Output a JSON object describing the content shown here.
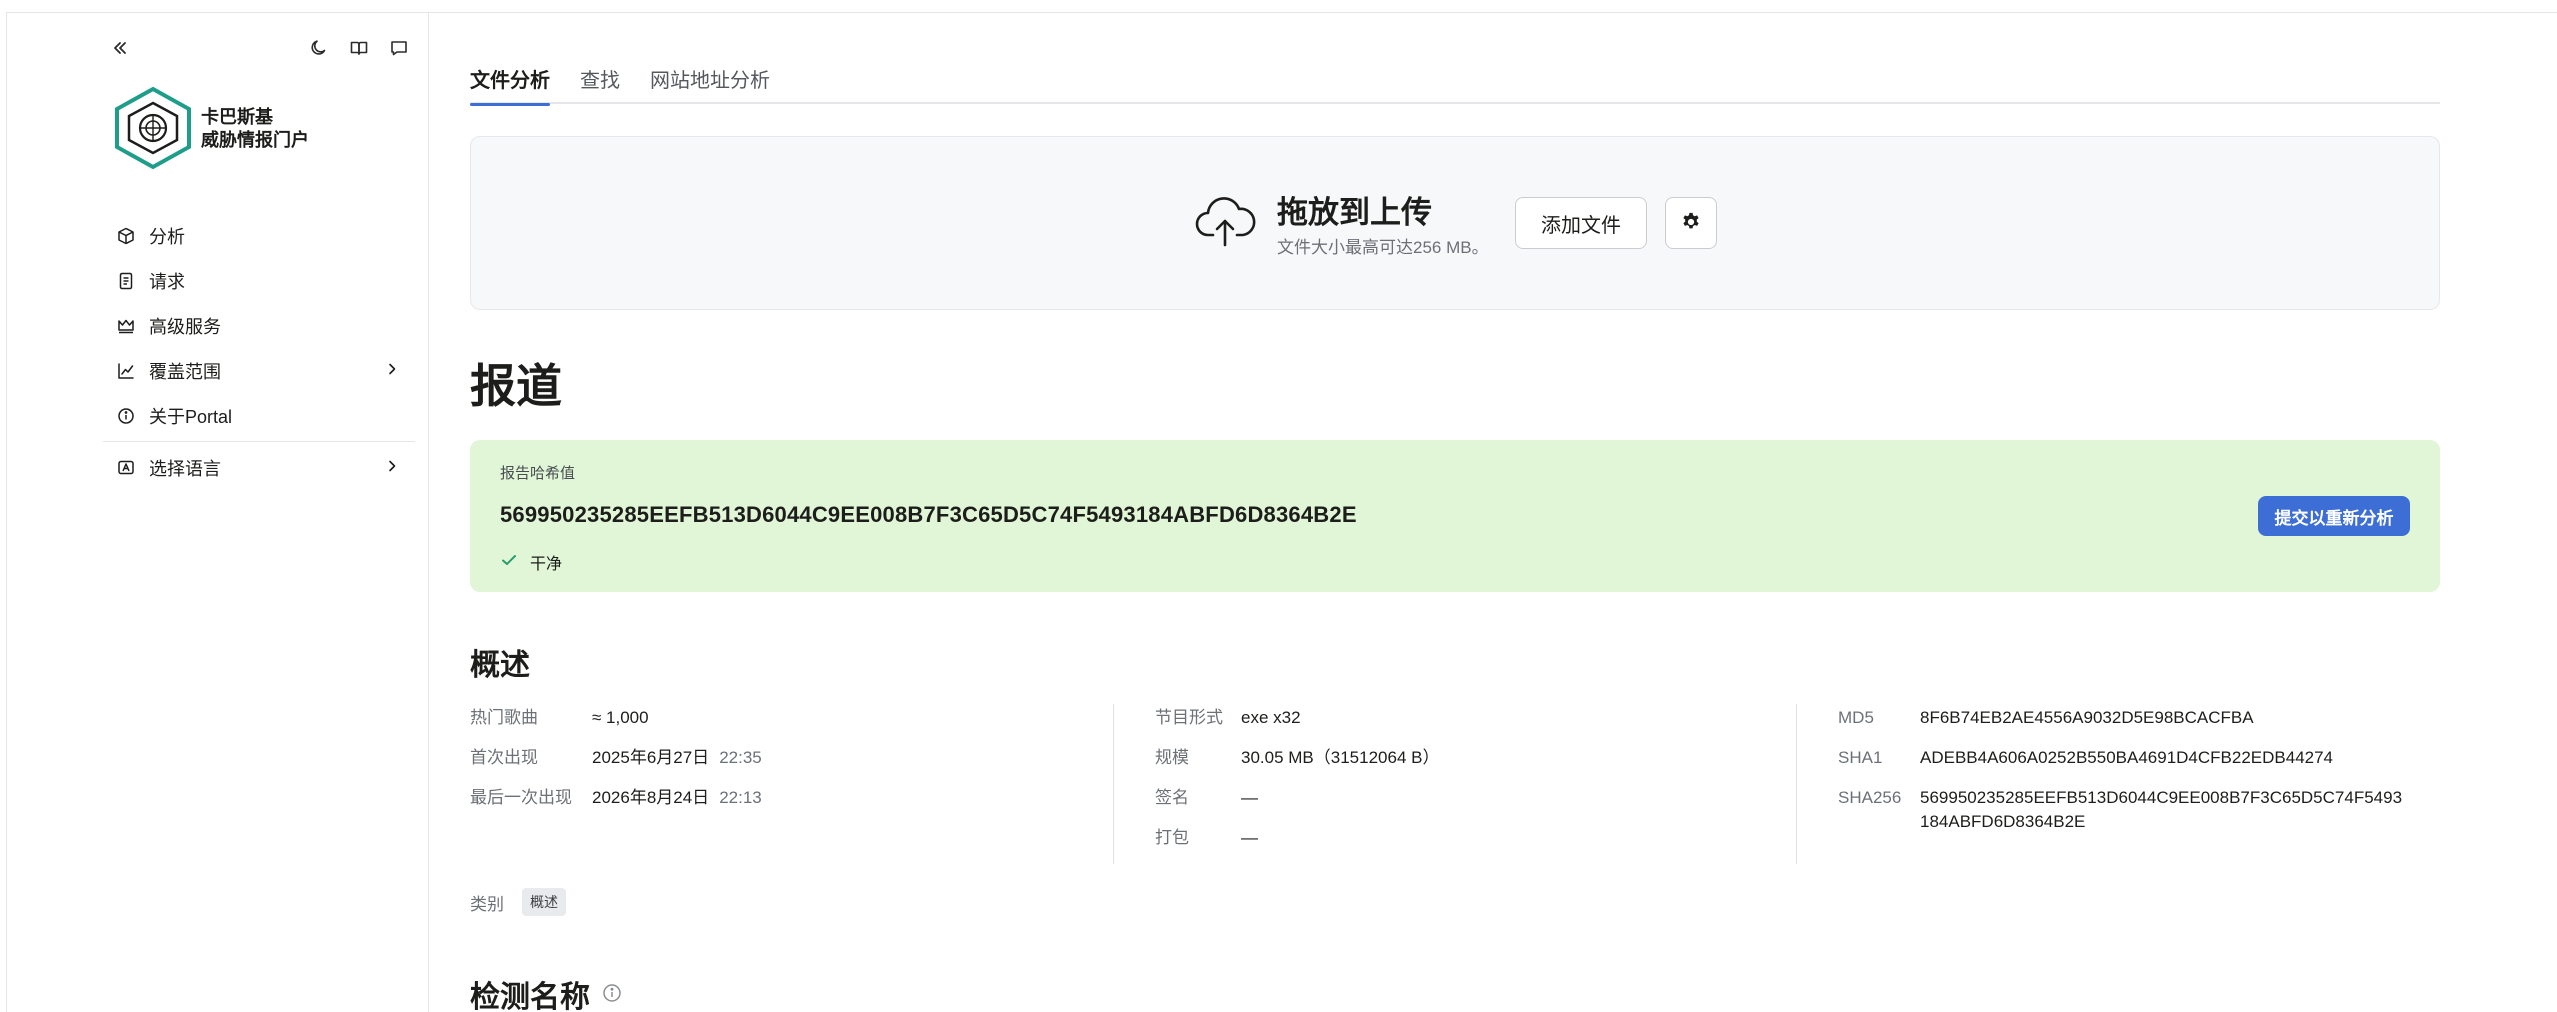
{
  "sidebar": {
    "brand_line1": "卡巴斯基",
    "brand_line2": "威胁情报门户",
    "items": [
      {
        "label": "分析",
        "icon": "cube-icon"
      },
      {
        "label": "请求",
        "icon": "document-icon"
      },
      {
        "label": "高级服务",
        "icon": "crown-icon"
      },
      {
        "label": "覆盖范围",
        "icon": "chart-line-icon"
      },
      {
        "label": "关于Portal",
        "icon": "info-icon"
      },
      {
        "label": "选择语言",
        "icon": "language-icon"
      }
    ]
  },
  "tabs": [
    "文件分析",
    "查找",
    "网站地址分析"
  ],
  "upload": {
    "title": "拖放到上传",
    "subtitle": "文件大小最高可达256 MB。",
    "add_button": "添加文件"
  },
  "report": {
    "heading": "报道",
    "hash_label": "报告哈希值",
    "hash": "569950235285EEFB513D6044C9EE008B7F3C65D5C74F5493184ABFD6D8364B2E",
    "status": "干净",
    "resubmit_button": "提交以重新分析"
  },
  "overview": {
    "heading": "概述",
    "col1": [
      {
        "key": "热门歌曲",
        "value": "≈ 1,000",
        "time": ""
      },
      {
        "key": "首次出现",
        "value": "2025年6月27日",
        "time": "22:35"
      },
      {
        "key": "最后一次出现",
        "value": "2026年8月24日",
        "time": "22:13"
      }
    ],
    "col2": [
      {
        "key": "节目形式",
        "value": "exe x32"
      },
      {
        "key": "规模",
        "value": "30.05 MB（31512064 B）"
      },
      {
        "key": "签名",
        "value": "—"
      },
      {
        "key": "打包",
        "value": "—"
      }
    ],
    "col3": [
      {
        "key": "MD5",
        "value": "8F6B74EB2AE4556A9032D5E98BCACFBA"
      },
      {
        "key": "SHA1",
        "value": "ADEBB4A606A0252B550BA4691D4CFB22EDB44274"
      },
      {
        "key": "SHA256",
        "value_line1": "569950235285EEFB513D6044C9EE008B7F3C65D5C74F5493",
        "value_line2": "184ABFD6D8364B2E"
      }
    ],
    "category_key": "类别",
    "category_chip": "概述"
  },
  "detection": {
    "heading": "检测名称"
  },
  "colors": {
    "accent": "#3d6ed6",
    "clean_bg": "#e0f6d6",
    "brand_green": "#1e9e8a",
    "check_green": "#2a9d6e"
  }
}
